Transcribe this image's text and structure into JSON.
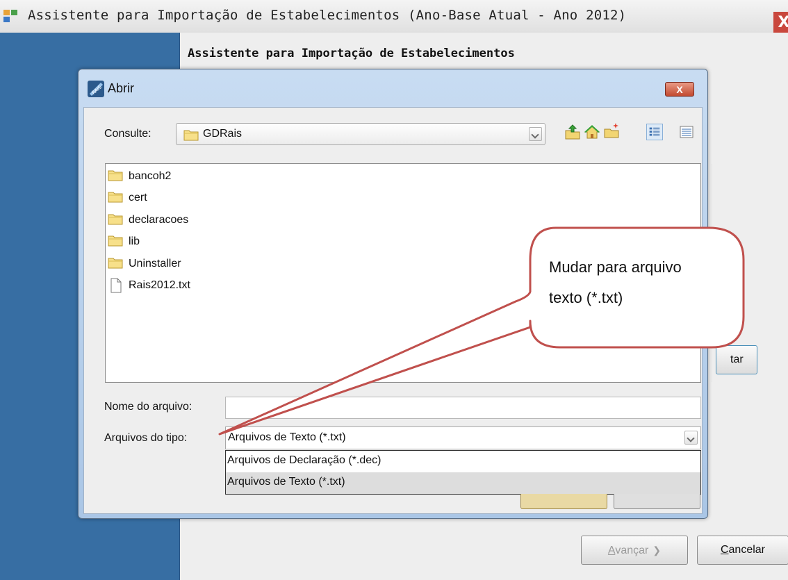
{
  "window": {
    "title": "Assistente para Importação de Estabelecimentos (Ano-Base Atual - Ano 2012)",
    "close_label": "X"
  },
  "wizard": {
    "heading": "Assistente para Importação de Estabelecimentos",
    "behind_button_label": "tar",
    "next_label": "Avançar",
    "next_mnemonic": "A",
    "next_rest": "vançar",
    "cancel_mnemonic": "C",
    "cancel_rest": "ancelar"
  },
  "dialog": {
    "title": "Abrir",
    "close_label": "X",
    "look_in_label": "Consulte:",
    "look_in_value": "GDRais",
    "toolbar": [
      "up-one-level-icon",
      "home-icon",
      "new-folder-icon",
      "list-view-icon",
      "details-view-icon"
    ],
    "files": [
      {
        "name": "bancoh2",
        "type": "folder"
      },
      {
        "name": "cert",
        "type": "folder"
      },
      {
        "name": "declaracoes",
        "type": "folder"
      },
      {
        "name": "lib",
        "type": "folder"
      },
      {
        "name": "Uninstaller",
        "type": "folder"
      },
      {
        "name": "Rais2012.txt",
        "type": "file"
      }
    ],
    "file_name_label": "Nome do arquivo:",
    "file_name_value": "",
    "file_type_label": "Arquivos do tipo:",
    "file_type_value": "Arquivos de Texto (*.txt)",
    "file_type_options": [
      {
        "label": "Arquivos de Declaração (*.dec)",
        "selected": false
      },
      {
        "label": "Arquivos de Texto (*.txt)",
        "selected": true
      }
    ]
  },
  "callout": {
    "line1": "Mudar para arquivo",
    "line2": "texto (*.txt)",
    "border_color": "#c0504d"
  },
  "colors": {
    "left_rail": "#376ea3",
    "dialog_frame": "#b8d0ec"
  }
}
